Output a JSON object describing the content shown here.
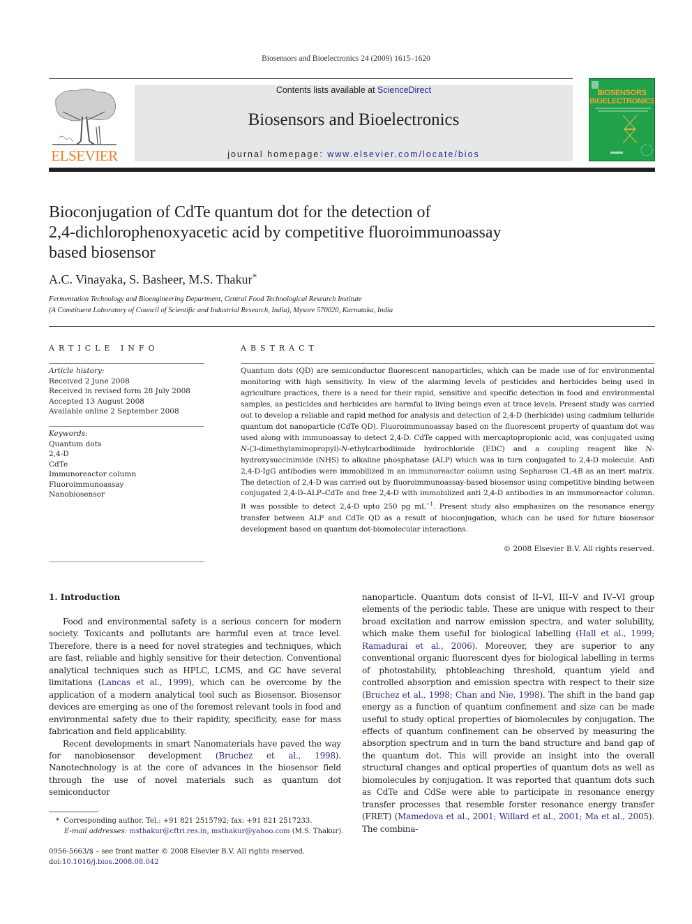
{
  "running_head": "Biosensors and Bioelectronics 24 (2009) 1615–1620",
  "masthead": {
    "contents_prefix": "Contents lists available at ",
    "contents_link": "ScienceDirect",
    "journal_title": "Biosensors and Bioelectronics",
    "homepage_prefix": "journal homepage: ",
    "homepage_link": "www.elsevier.com/locate/bios",
    "publisher_logo_text": "ELSEVIER",
    "cover_title_line1": "BIOSENSORS",
    "cover_title_line2": "BIOELECTRONICS",
    "colors": {
      "band": "#e6e7e8",
      "link": "#2a2a8a",
      "elsevier_orange": "#f47a20",
      "cover_green": "#1fa24a",
      "cover_title": "#f2a33a"
    }
  },
  "article": {
    "title_lines": [
      "Bioconjugation of CdTe quantum dot for the detection of",
      "2,4-dichlorophenoxyacetic acid by competitive fluoroimmunoassay",
      "based biosensor"
    ],
    "authors": "A.C. Vinayaka, S. Basheer, M.S. Thakur",
    "corresponding_marker": "*",
    "affiliation_lines": [
      "Fermentation Technology and Bioengineering Department, Central Food Technological Research Institute",
      "(A Constituent Laboratory of Council of Scientific and Industrial Research, India), Mysore 570020, Karnataka, India"
    ]
  },
  "article_info": {
    "heading": "ARTICLE INFO",
    "history_label": "Article history:",
    "history": [
      "Received 2 June 2008",
      "Received in revised form 28 July 2008",
      "Accepted 13 August 2008",
      "Available online 2 September 2008"
    ],
    "keywords_label": "Keywords:",
    "keywords": [
      "Quantum dots",
      "2,4-D",
      "CdTe",
      "Immunoreactor column",
      "Fluoroimmunoassay",
      "Nanobiosensor"
    ]
  },
  "abstract": {
    "heading": "ABSTRACT",
    "part1": "Quantum dots (QD) are semiconductor fluorescent nanoparticles, which can be made use of for environmental monitoring with high sensitivity. In view of the alarming levels of pesticides and herbicides being used in agriculture practices, there is a need for their rapid, sensitive and specific detection in food and environmental samples, as pesticides and herbicides are harmful to living beings even at trace levels. Present study was carried out to develop a reliable and rapid method for analysis and detection of 2,4-D (herbicide) using cadmium telluride quantum dot nanoparticle (CdTe QD). Fluoroimmunoassay based on the fluorescent property of quantum dot was used along with immunoassay to detect 2,4-D. CdTe capped with mercaptopropionic acid, was conjugated using ",
    "italic_n1": "N",
    "part2": "-(3-dimethylaminopropyl)-",
    "italic_n2": "N",
    "part3": "-ethylcarbodiimide hydrochloride (EDC) and a coupling reagent like ",
    "italic_n3": "N",
    "part4": "-hydroxysuccinimide (NHS) to alkaline phosphatase (ALP) which was in turn conjugated to 2,4-D molecule. Anti 2,4-D-IgG antibodies were immobilized in an immunoreactor column using Sepharose CL-4B as an inert matrix. The detection of 2,4-D was carried out by fluoroimmunoassay-based biosensor using competitive binding between conjugated 2,4-D–ALP–CdTe and free 2,4-D with immobilized anti 2,4-D antibodies in an immunoreactor column. It was possible to detect 2,4-D upto 250 pg mL",
    "superscript": "−1",
    "part5": ". Present study also emphasizes on the resonance energy transfer between ALP and CdTe QD as a result of bioconjugation, which can be used for future biosensor development based on quantum dot-biomolecular interactions.",
    "copyright": "© 2008 Elsevier B.V. All rights reserved."
  },
  "introduction": {
    "heading": "1.  Introduction",
    "p1_a": "Food and environmental safety is a serious concern for modern society. Toxicants and pollutants are harmful even at trace level. Therefore, there is a need for novel strategies and techniques, which are fast, reliable and highly sensitive for their detection. Conventional analytical techniques such as HPLC, LCMS, and GC have several limitations (",
    "p1_cite": "Lancas et al., 1999",
    "p1_b": "), which can be overcome by the application of a modern analytical tool such as Biosensor. Biosensor devices are emerging as one of the foremost relevant tools in food and environmental safety due to their rapidity, specificity, ease for mass fabrication and field applicability.",
    "p2_a": "Recent developments in smart Nanomaterials have paved the way for nanobiosensor development (",
    "p2_cite": "Bruchez et al., 1998",
    "p2_b": "). Nanotechnology is at the core of advances in the biosensor field through the use of novel materials such as quantum dot semiconductor",
    "r_a": "nanoparticle. Quantum dots consist of II–VI, III–V and IV–VI group elements of the periodic table. These are unique with respect to their broad excitation and narrow emission spectra, and water solubility, which make them useful for biological labelling (",
    "r_cite1": "Hall et al., 1999; Ramadurai et al., 2006",
    "r_b": "). Moreover, they are superior to any conventional organic fluorescent dyes for biological labelling in terms of photostability, phtobleaching threshold, quantum yield and controlled absorption and emission spectra with respect to their size (",
    "r_cite2": "Bruchez et al., 1998; Chan and Nie, 1998",
    "r_c": "). The shift in the band gap energy as a function of quantum confinement and size can be made useful to study optical properties of biomolecules by conjugation. The effects of quantum confinement can be observed by measuring the absorption spectrum and in turn the band structure and band gap of the quantum dot. This will provide an insight into the overall structural changes and optical properties of quantum dots as well as biomolecules by conjugation. It was reported that quantum dots such as CdTe and CdSe were able to participate in resonance energy transfer processes that resemble forster resonance energy transfer (FRET) (",
    "r_cite3": "Mamedova et al., 2001; Willard et al., 2001; Ma et al., 2005",
    "r_d": "). The combina-"
  },
  "footnote": {
    "marker": "*",
    "corresponding": "Corresponding author. Tel.: +91 821 2515792; fax: +91 821 2517233.",
    "email_label": "E-mail addresses:",
    "email1": "msthakur@cftri.res.in",
    "sep": ", ",
    "email2": "msthakur@yahoo.com",
    "email_suffix": " (M.S. Thakur)."
  },
  "front_matter": {
    "issn_line": "0956-5663/$ – see front matter © 2008 Elsevier B.V. All rights reserved.",
    "doi_prefix": "doi:",
    "doi_link": "10.1016/j.bios.2008.08.042"
  }
}
